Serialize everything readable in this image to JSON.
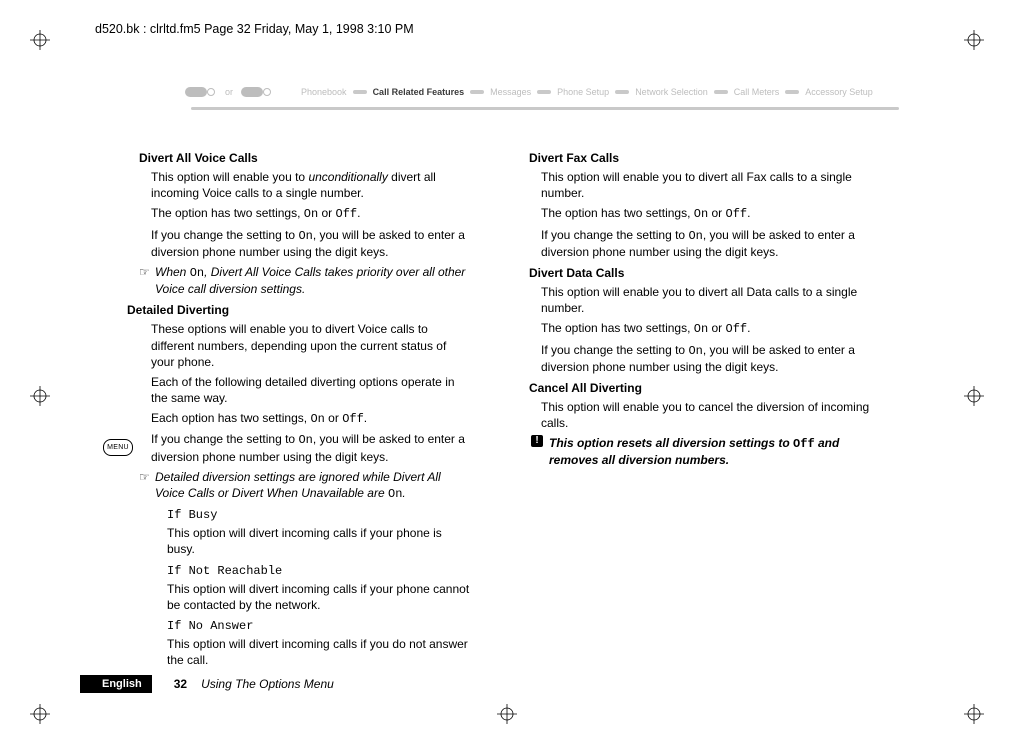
{
  "framemaker_header": "d520.bk : clrltd.fm5  Page 32  Friday, May 1, 1998  3:10 PM",
  "menu": {
    "items": [
      "Phonebook",
      "Call Related Features",
      "Messages",
      "Phone Setup",
      "Network Selection",
      "Call Meters",
      "Accessory Setup"
    ],
    "key_separator": "or"
  },
  "left": {
    "h_divert_all": "Divert All Voice Calls",
    "divert_all_p1a": "This option will enable you to ",
    "divert_all_p1b": "unconditionally",
    "divert_all_p1c": " divert all incoming Voice calls to a single number.",
    "divert_all_p2a": "The option has two settings, ",
    "on": "On",
    "off": "Off",
    "or_word": " or ",
    "period": ".",
    "divert_all_p3a": "If you change the setting to ",
    "divert_all_p3b": ", you will be asked to enter a diversion phone number using the digit keys.",
    "note1a": "When ",
    "note1b": ", Divert All Voice Calls takes priority over all other Voice call diversion settings.",
    "h_detailed": "Detailed Diverting",
    "det_p1": "These options will enable you to divert Voice calls to different numbers, depending upon the current status of your phone.",
    "det_p2": "Each of the following detailed diverting options operate in the same way.",
    "det_p3a": "Each option has two settings, ",
    "det_p4a": "If you change the setting to ",
    "det_p4b": ", you will be asked to enter a diversion phone number using the digit keys.",
    "note2": "Detailed diversion settings are ignored while Divert All Voice Calls or Divert When Unavailable are ",
    "if_busy": "If Busy",
    "if_busy_d": "This option will divert incoming calls if your phone is busy.",
    "if_nr": "If Not Reachable",
    "if_nr_d": "This option will divert incoming calls if your phone cannot be contacted by the network.",
    "if_na": "If No Answer",
    "if_na_d": "This option will divert incoming calls if you do not answer the call."
  },
  "right": {
    "h_fax": "Divert Fax Calls",
    "fax_p1": "This option will enable you to divert all Fax calls to a single number.",
    "opt2a": "The option has two settings, ",
    "setOn_p_a": "If you change the setting to ",
    "setOn_p_b": ", you will be asked to enter a diversion phone number using the digit keys.",
    "h_data": "Divert Data Calls",
    "data_p1": "This option will enable you to divert all Data calls to a single number.",
    "h_cancel": "Cancel All Diverting",
    "cancel_p1": "This option will enable you to cancel the diversion of incoming calls.",
    "warn_a": "This option resets all diversion settings to ",
    "warn_b": " and removes all diversion numbers."
  },
  "sidebar": {
    "menu_badge": "MENU"
  },
  "footer": {
    "lang": "English",
    "page": "32",
    "title": "Using The Options Menu"
  },
  "glyphs": {
    "note": "☞",
    "warn": "!"
  }
}
